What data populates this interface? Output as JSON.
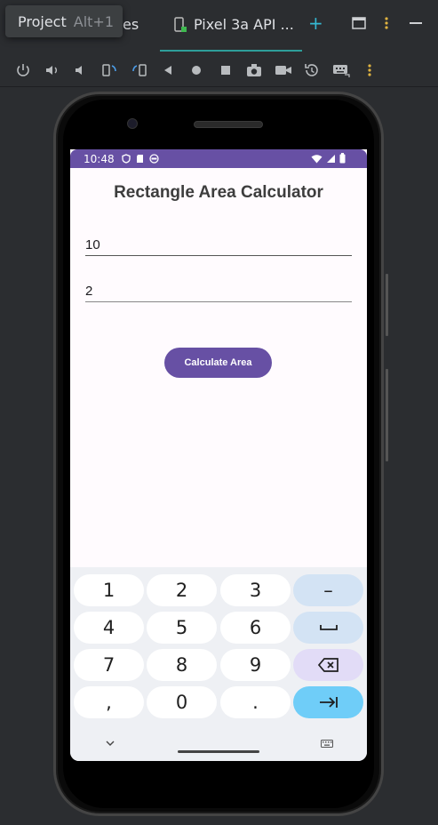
{
  "tabbar": {
    "partial_tab_label": "es",
    "device_tab_label": "Pixel 3a API ...",
    "add_label": "+"
  },
  "tooltip": {
    "label": "Project",
    "shortcut": "Alt+1"
  },
  "colors": {
    "ide_bg": "#2b2d30",
    "accent": "#6750a4",
    "tab_underline": "#2e9e9a",
    "screen_bg": "#fffbfe"
  },
  "toolbar": {
    "icons": [
      "power-icon",
      "volume-up-icon",
      "volume-down-icon",
      "rotate-left-icon",
      "rotate-right-icon",
      "back-icon",
      "home-icon",
      "overview-icon",
      "camera-icon",
      "video-icon",
      "snapshot-icon",
      "keyboard-icon",
      "more-icon"
    ]
  },
  "phone": {
    "status": {
      "time": "10:48"
    },
    "app": {
      "title": "Rectangle Area Calculator",
      "length_value": "10",
      "width_value": "2",
      "button_label": "Calculate Area"
    },
    "keyboard": {
      "keys": [
        "1",
        "2",
        "3",
        "–",
        "4",
        "5",
        "6",
        "␣",
        "7",
        "8",
        "9",
        "⌫",
        ",",
        "0",
        ".",
        "⇥"
      ]
    }
  }
}
